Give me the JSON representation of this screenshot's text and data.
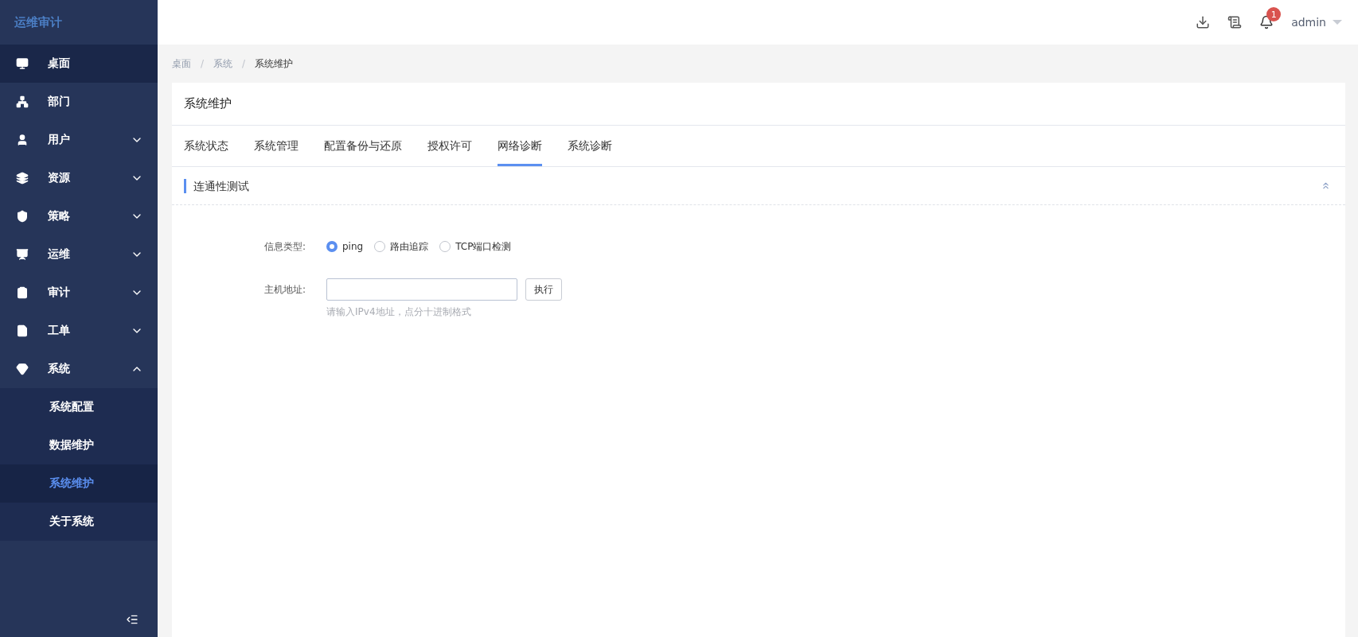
{
  "sidebar": {
    "logo": "运维审计",
    "items": [
      {
        "label": "桌面",
        "kind": "link",
        "selected": true
      },
      {
        "label": "部门",
        "kind": "link",
        "selected": false
      },
      {
        "label": "用户",
        "kind": "group",
        "expanded": false,
        "selected": false
      },
      {
        "label": "资源",
        "kind": "group",
        "expanded": false,
        "selected": false
      },
      {
        "label": "策略",
        "kind": "group",
        "expanded": false,
        "selected": false
      },
      {
        "label": "运维",
        "kind": "group",
        "expanded": false,
        "selected": false
      },
      {
        "label": "审计",
        "kind": "group",
        "expanded": false,
        "selected": false
      },
      {
        "label": "工单",
        "kind": "group",
        "expanded": false,
        "selected": false
      },
      {
        "label": "系统",
        "kind": "group",
        "expanded": true,
        "selected": false,
        "children": [
          {
            "label": "系统配置",
            "selected": false
          },
          {
            "label": "数据维护",
            "selected": false
          },
          {
            "label": "系统维护",
            "selected": true
          },
          {
            "label": "关于系统",
            "selected": false
          }
        ]
      }
    ]
  },
  "header": {
    "notification_count": "1",
    "user": "admin"
  },
  "breadcrumb": [
    {
      "kind": "link",
      "text": "桌面"
    },
    {
      "kind": "separator",
      "text": "/"
    },
    {
      "kind": "link",
      "text": "系统"
    },
    {
      "kind": "separator",
      "text": "/"
    },
    {
      "kind": "current",
      "text": "系统维护"
    }
  ],
  "page": {
    "title": "系统维护",
    "tabs": [
      {
        "label": "系统状态",
        "selected": false
      },
      {
        "label": "系统管理",
        "selected": false
      },
      {
        "label": "配置备份与还原",
        "selected": false
      },
      {
        "label": "授权许可",
        "selected": false
      },
      {
        "label": "网络诊断",
        "selected": true
      },
      {
        "label": "系统诊断",
        "selected": false
      }
    ],
    "section": {
      "title": "连通性测试",
      "expanded": true
    },
    "form": {
      "type_label": "信息类型:",
      "options": [
        {
          "label": "ping",
          "selected": true
        },
        {
          "label": "路由追踪",
          "selected": false
        },
        {
          "label": "TCP端口检测",
          "selected": false
        }
      ],
      "host_label": "主机地址:",
      "hint": "请输入IPv4地址，点分十进制格式",
      "button": "执行"
    }
  }
}
